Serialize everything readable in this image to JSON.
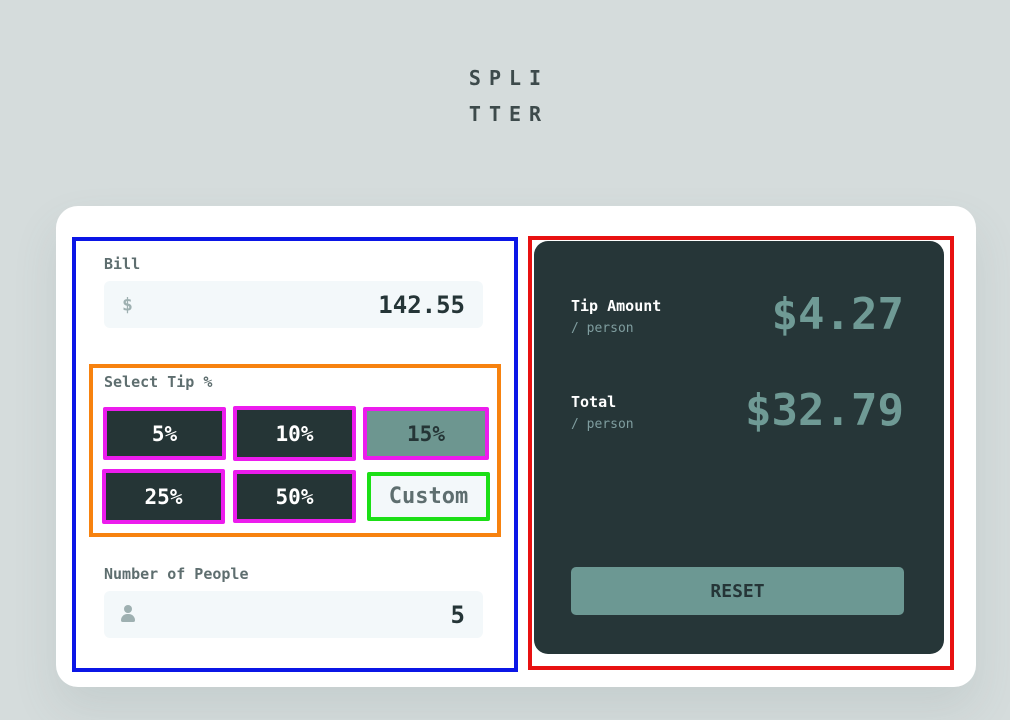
{
  "logo": {
    "line1": "SPLI",
    "line2": "TTER"
  },
  "bill": {
    "label": "Bill",
    "currency_symbol": "$",
    "value": "142.55"
  },
  "tip": {
    "label": "Select Tip %",
    "options": [
      "5%",
      "10%",
      "15%",
      "25%",
      "50%"
    ],
    "selected": "15%",
    "custom_placeholder": "Custom"
  },
  "people": {
    "label": "Number of People",
    "value": "5"
  },
  "results": {
    "tip_label": "Tip Amount",
    "tip_sub": "/ person",
    "tip_value": "$4.27",
    "total_label": "Total",
    "total_sub": "/ person",
    "total_value": "$32.79",
    "reset_label": "RESET"
  },
  "colors": {
    "background": "#d5dcdc",
    "panel": "#263638",
    "accent": "#6c9893",
    "annotation_blue": "#0b16e6",
    "annotation_red": "#e81111",
    "annotation_orange": "#f7820f",
    "annotation_magenta": "#ec1ced",
    "annotation_green": "#1bdf16"
  }
}
